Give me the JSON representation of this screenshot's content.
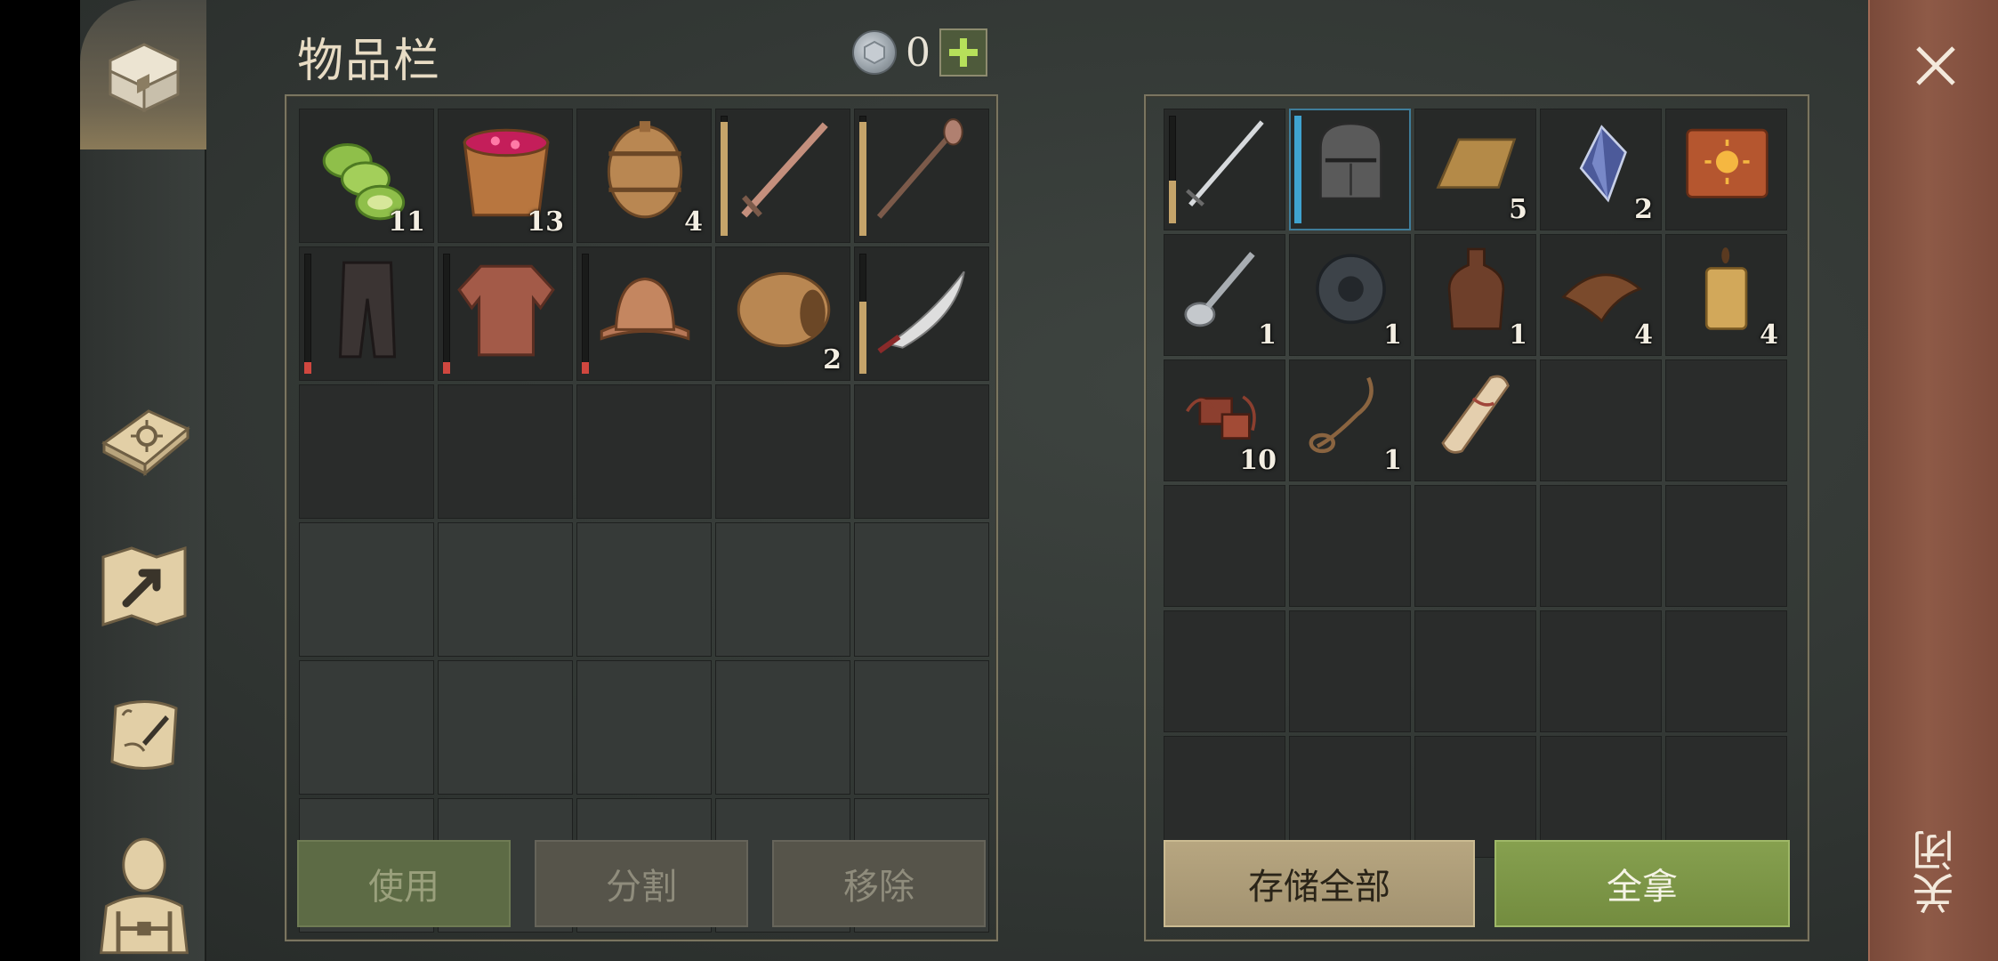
{
  "title": "物品栏",
  "currency": {
    "icon": "silver-coin-icon",
    "amount": "0"
  },
  "inventory": {
    "items": [
      {
        "name": "cucumber-slices",
        "qty": "11"
      },
      {
        "name": "berry-bucket",
        "qty": "13"
      },
      {
        "name": "barrel-small",
        "qty": "4"
      },
      {
        "name": "sword-bronze",
        "durability": 0.95,
        "durability_color": "#c5a46a"
      },
      {
        "name": "mace",
        "durability": 0.95,
        "durability_color": "#c5a46a"
      },
      {
        "name": "leather-pants",
        "durability": 0.1,
        "durability_color": "#d0473f"
      },
      {
        "name": "chainmail-shirt",
        "durability": 0.1,
        "durability_color": "#d0473f"
      },
      {
        "name": "kettle-helmet",
        "durability": 0.1,
        "durability_color": "#d0473f"
      },
      {
        "name": "barrel-wide",
        "qty": "2"
      },
      {
        "name": "scimitar",
        "durability": 0.6,
        "durability_color": "#c5a46a"
      }
    ]
  },
  "buttons": {
    "use": "使用",
    "split": "分割",
    "remove": "移除",
    "store_all": "存储全部",
    "take_all": "全拿"
  },
  "container": {
    "items": [
      {
        "name": "longsword-steel",
        "durability": 0.4,
        "durability_color": "#c5a46a"
      },
      {
        "name": "great-helm",
        "durability": 1.0,
        "durability_color": "#3fa3d0"
      },
      {
        "name": "copper-ingot",
        "qty": "5"
      },
      {
        "name": "crystal-shard",
        "qty": "2"
      },
      {
        "name": "sun-book"
      },
      {
        "name": "spoon",
        "qty": "1"
      },
      {
        "name": "gear",
        "qty": "1"
      },
      {
        "name": "bottle",
        "qty": "1"
      },
      {
        "name": "leather-strips",
        "qty": "4"
      },
      {
        "name": "candle",
        "qty": "4"
      },
      {
        "name": "scrap-pile",
        "qty": "10"
      },
      {
        "name": "rope-noose",
        "qty": "1"
      },
      {
        "name": "scroll"
      }
    ]
  },
  "close_label": "关闭",
  "colors": {
    "accent_gold": "#b7a680",
    "accent_green": "#86a04f",
    "close_rail": "#8e5a47"
  }
}
